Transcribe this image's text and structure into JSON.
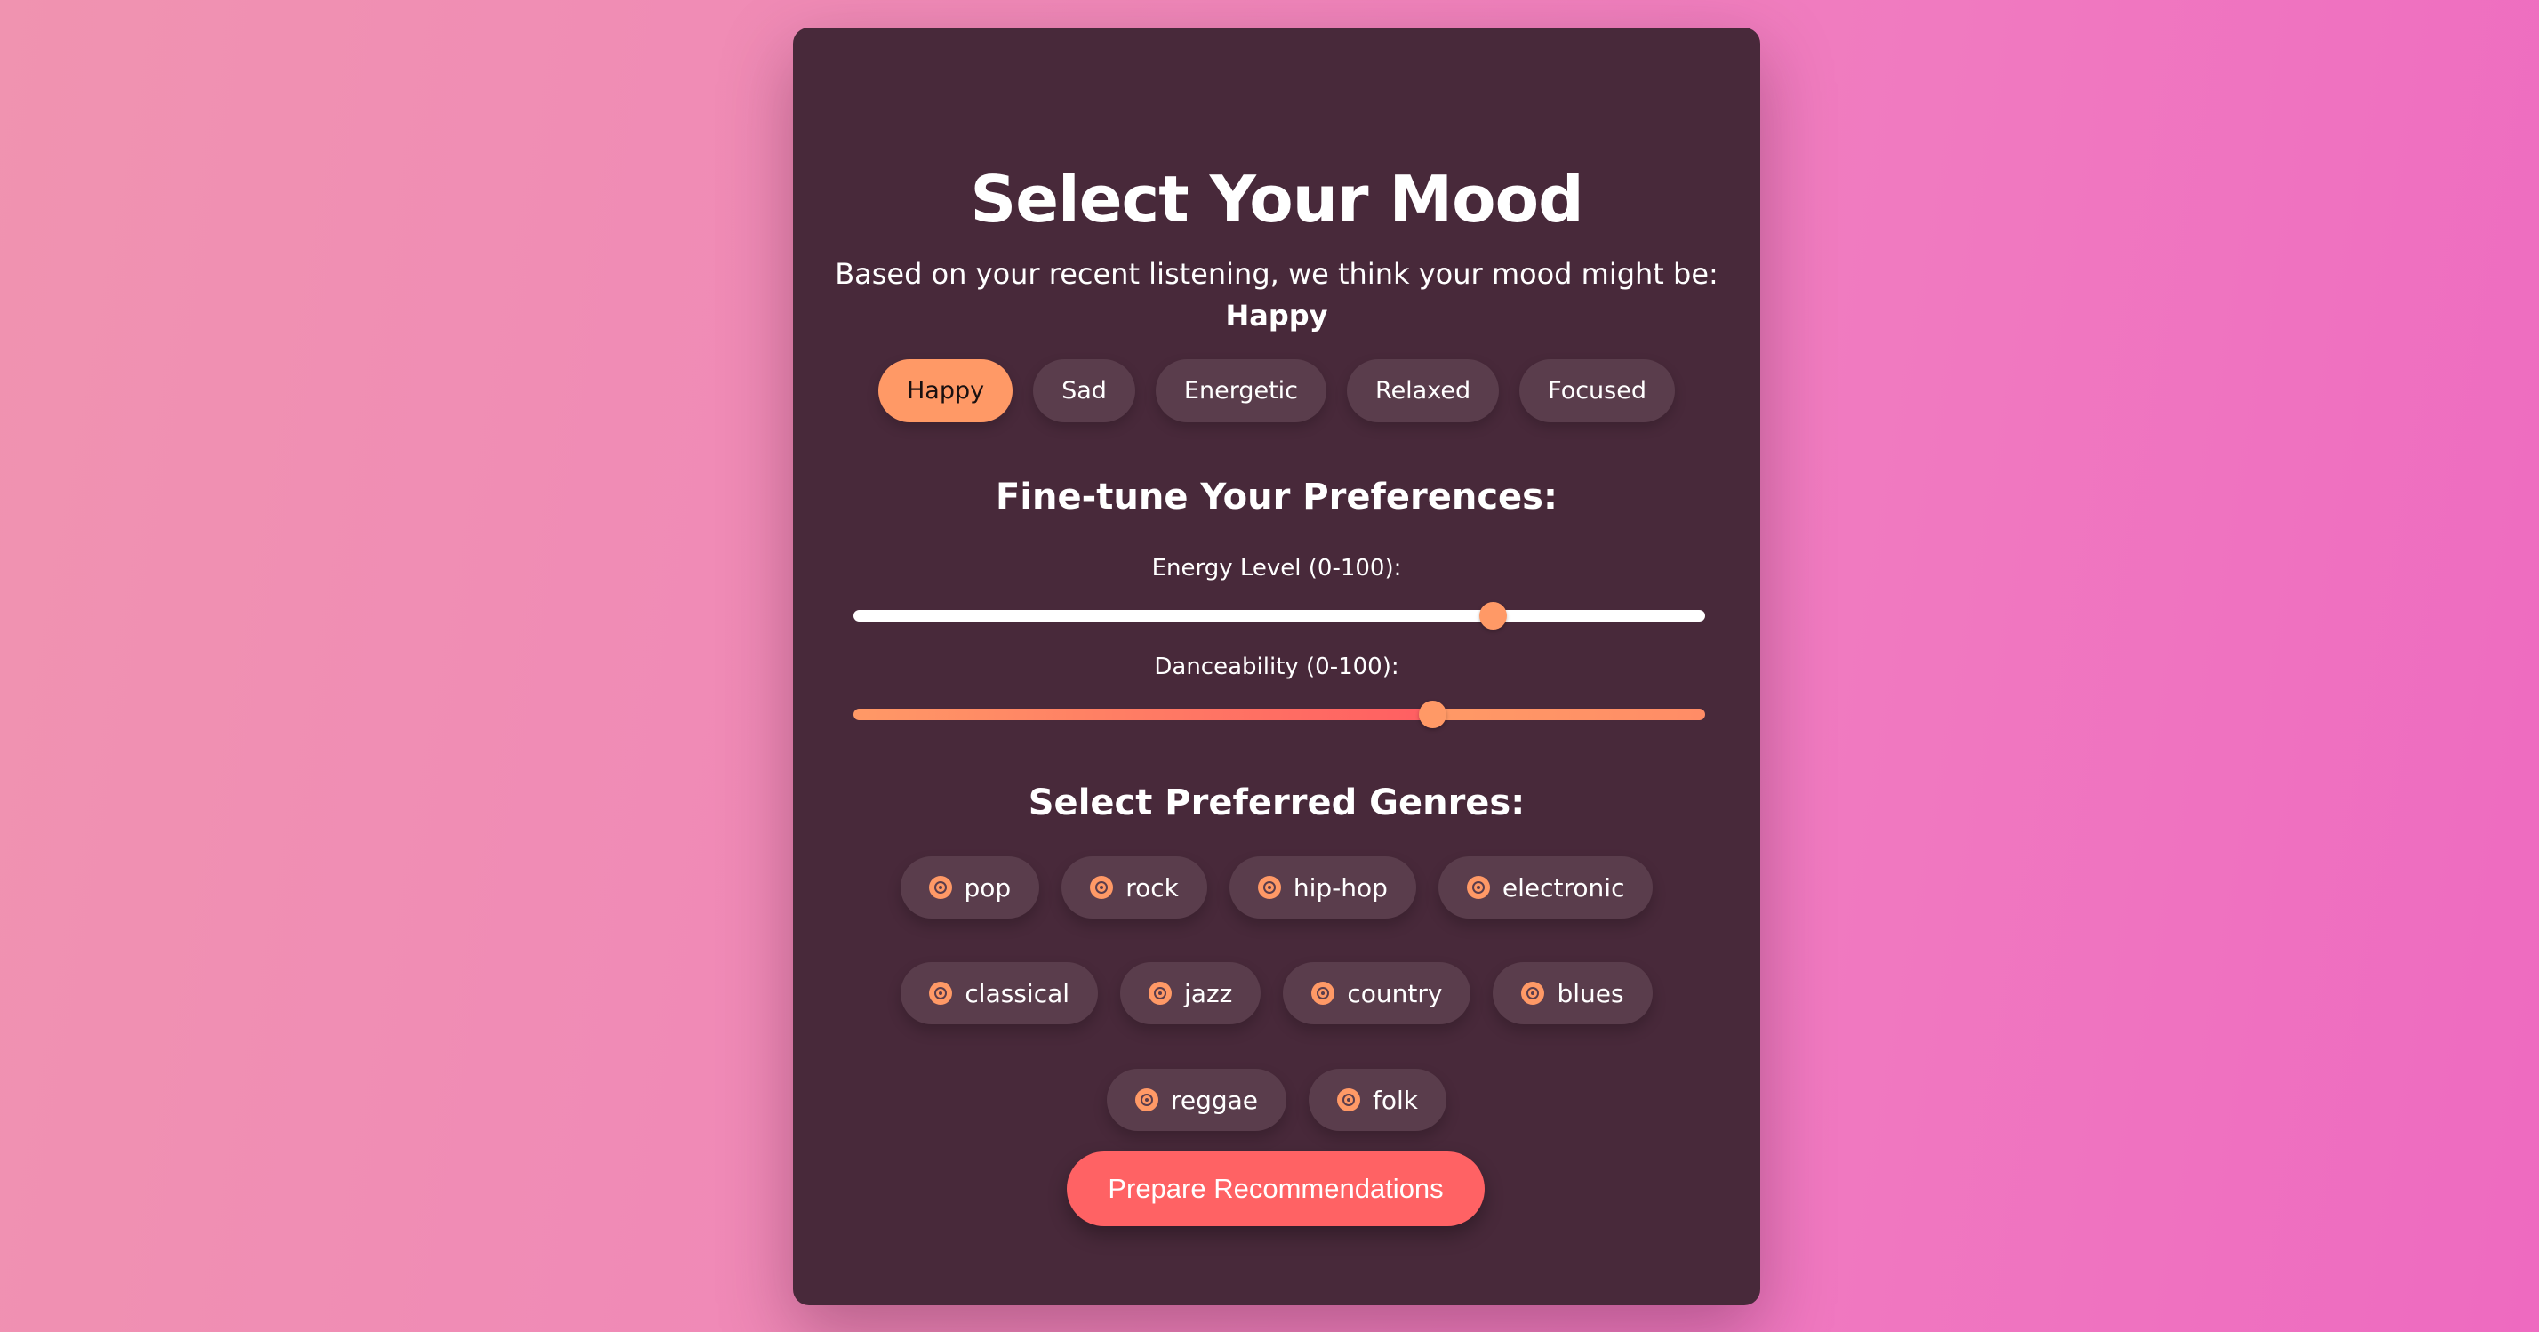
{
  "header": {
    "title": "Select Your Mood",
    "subtitle": "Based on your recent listening, we think your mood might be:",
    "detected_mood": "Happy"
  },
  "moods": [
    {
      "label": "Happy",
      "selected": true
    },
    {
      "label": "Sad",
      "selected": false
    },
    {
      "label": "Energetic",
      "selected": false
    },
    {
      "label": "Relaxed",
      "selected": false
    },
    {
      "label": "Focused",
      "selected": false
    }
  ],
  "preferences": {
    "heading": "Fine-tune Your Preferences:",
    "energy": {
      "label": "Energy Level (0-100):",
      "value": 75,
      "min": 0,
      "max": 100
    },
    "danceability": {
      "label": "Danceability (0-100):",
      "value": 68,
      "min": 0,
      "max": 100
    }
  },
  "genres": {
    "heading": "Select Preferred Genres:",
    "icon": "vinyl-disc-icon",
    "items": [
      "pop",
      "rock",
      "hip-hop",
      "electronic",
      "classical",
      "jazz",
      "country",
      "blues",
      "reggae",
      "folk"
    ]
  },
  "action": {
    "label": "Prepare Recommendations"
  },
  "colors": {
    "accent": "#ff9966",
    "cta": "#ff6264",
    "card": "#48293a",
    "chip": "#5a3d4c"
  }
}
